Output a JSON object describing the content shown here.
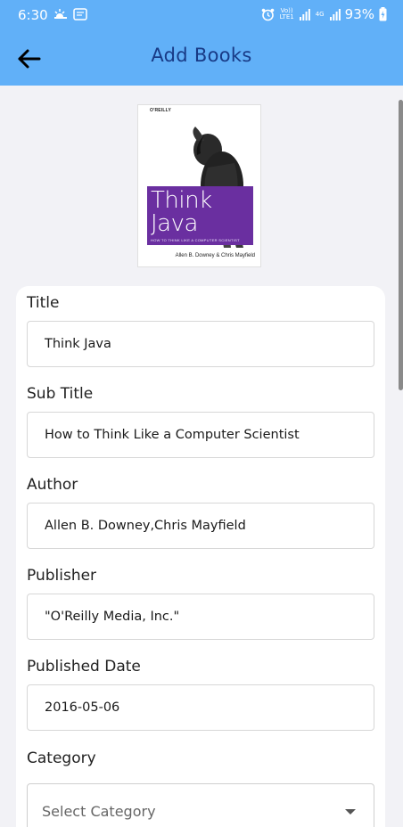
{
  "status_bar": {
    "time": "6:30",
    "signal_1": "Vo)) LTE1",
    "signal_2": "4G",
    "battery": "93%"
  },
  "app_bar": {
    "title": "Add Books",
    "back_icon": "arrow-left-icon"
  },
  "cover": {
    "publisher": "O'REILLY",
    "title_line1": "Think",
    "title_line2": "Java",
    "tagline": "HOW TO THINK LIKE A COMPUTER SCIENTIST",
    "authors": "Allen B. Downey & Chris Mayfield"
  },
  "form": {
    "title": {
      "label": "Title",
      "value": "Think Java"
    },
    "subtitle": {
      "label": "Sub Title",
      "value": "How to Think Like a Computer Scientist"
    },
    "author": {
      "label": "Author",
      "value": "Allen B. Downey,Chris Mayfield"
    },
    "publisher": {
      "label": "Publisher",
      "value": "\"O'Reilly Media, Inc.\""
    },
    "published_date": {
      "label": "Published Date",
      "value": "2016-05-06"
    },
    "category": {
      "label": "Category",
      "placeholder": "Select Category"
    }
  },
  "colors": {
    "app_bar": "#61b0f8",
    "title_text": "#183a86",
    "background": "#f2f2f6",
    "cover_accent": "#6a2fa0"
  }
}
